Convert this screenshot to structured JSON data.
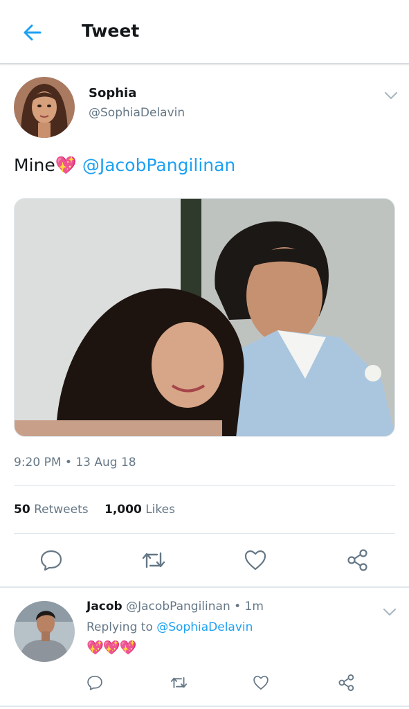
{
  "header": {
    "title": "Tweet",
    "back_icon": "arrow-left-icon"
  },
  "tweet": {
    "author_name": "Sophia",
    "author_handle": "@SophiaDelavin",
    "text": "Mine",
    "emoji": "💖",
    "mention": "@JacobPangilinan",
    "timestamp": "9:20 PM • 13 Aug 18",
    "retweets_count": "50",
    "retweets_label": "Retweets",
    "likes_count": "1,000",
    "likes_label": "Likes"
  },
  "reply": {
    "author_name": "Jacob",
    "author_handle": "@JacobPangilinan",
    "time": "• 1m",
    "replying_prefix": "Replying to",
    "replying_to": "@SophiaDelavin",
    "text": "💖💖💖"
  },
  "colors": {
    "accent": "#1da1f2",
    "secondary_text": "#657786",
    "divider": "#e1e8ed"
  }
}
